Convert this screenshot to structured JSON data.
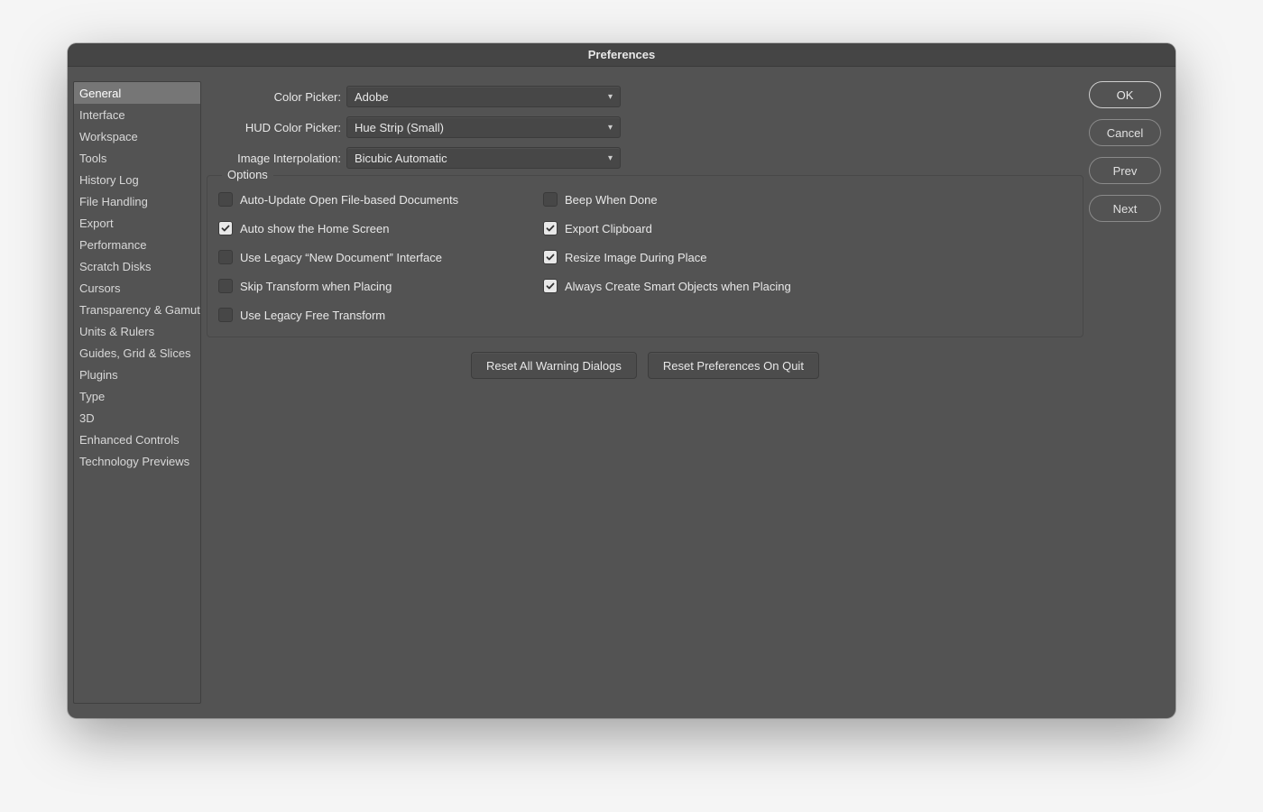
{
  "window": {
    "title": "Preferences"
  },
  "sidebar": {
    "items": [
      "General",
      "Interface",
      "Workspace",
      "Tools",
      "History Log",
      "File Handling",
      "Export",
      "Performance",
      "Scratch Disks",
      "Cursors",
      "Transparency & Gamut",
      "Units & Rulers",
      "Guides, Grid & Slices",
      "Plugins",
      "Type",
      "3D",
      "Enhanced Controls",
      "Technology Previews"
    ],
    "selected_index": 0
  },
  "dropdowns": {
    "color_picker": {
      "label": "Color Picker:",
      "value": "Adobe"
    },
    "hud": {
      "label": "HUD Color Picker:",
      "value": "Hue Strip (Small)"
    },
    "interpolation": {
      "label": "Image Interpolation:",
      "value": "Bicubic Automatic"
    }
  },
  "options": {
    "legend": "Options",
    "left": [
      {
        "label": "Auto-Update Open File-based Documents",
        "checked": false
      },
      {
        "label": "Auto show the Home Screen",
        "checked": true
      },
      {
        "label": "Use Legacy “New Document” Interface",
        "checked": false
      },
      {
        "label": "Skip Transform when Placing",
        "checked": false
      },
      {
        "label": "Use Legacy Free Transform",
        "checked": false
      }
    ],
    "right": [
      {
        "label": "Beep When Done",
        "checked": false
      },
      {
        "label": "Export Clipboard",
        "checked": true
      },
      {
        "label": "Resize Image During Place",
        "checked": true
      },
      {
        "label": "Always Create Smart Objects when Placing",
        "checked": true
      }
    ]
  },
  "bottom_buttons": {
    "reset_dialogs": "Reset All Warning Dialogs",
    "reset_prefs": "Reset Preferences On Quit"
  },
  "actions": {
    "ok": "OK",
    "cancel": "Cancel",
    "prev": "Prev",
    "next": "Next"
  }
}
